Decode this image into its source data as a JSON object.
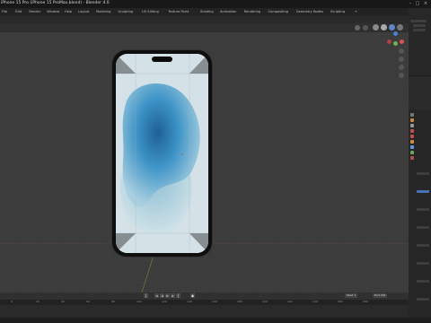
{
  "app": {
    "title": "iPhone 15 Pro (iPhone 15 ProMax.blend) - Blender 4.0",
    "accent": "#4772b3"
  },
  "menu": {
    "items": [
      "File",
      "Edit",
      "Render",
      "Window",
      "Help",
      "Layout",
      "Modeling",
      "Sculpting",
      "UV Editing",
      "Texture Paint",
      "Shading",
      "Animation",
      "Rendering",
      "Compositing",
      "Geometry Nodes",
      "Scripting",
      "+"
    ]
  },
  "timeline": {
    "ticks": [
      "0",
      "20",
      "40",
      "60",
      "80",
      "100",
      "120",
      "140",
      "160",
      "180",
      "200",
      "220",
      "240",
      "260",
      "280"
    ],
    "start_label": "Start",
    "start_value": "1",
    "end_label": "End",
    "end_value": "250"
  },
  "icons": {
    "play_back": "skip-start-icon",
    "play": "play-icon",
    "play_fwd": "skip-end-icon"
  },
  "colors": {
    "gizmo_x": "#e0504d",
    "gizmo_y": "#73b04f",
    "gizmo_z": "#4a7fd6",
    "gizmo_neg": "#aa4444",
    "hdr": [
      "#4fa0c8",
      "#c06a2a",
      "#6a9a4a",
      "#8888aa"
    ]
  }
}
